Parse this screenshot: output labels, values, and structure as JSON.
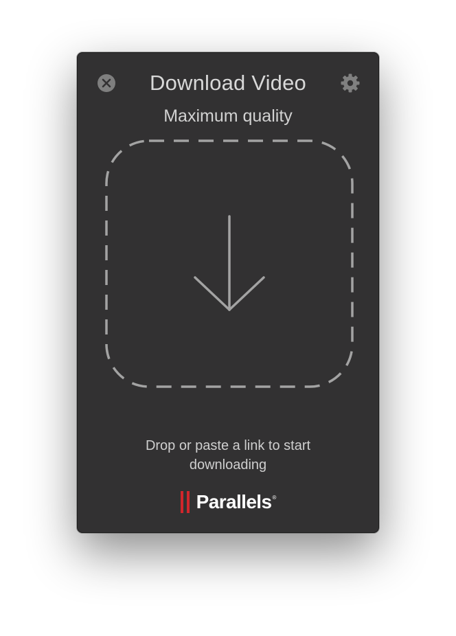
{
  "window": {
    "title": "Download Video",
    "subtitle": "Maximum quality"
  },
  "icons": {
    "close": "close-circle-icon",
    "settings": "gear-icon",
    "download": "arrow-down-icon"
  },
  "drop_zone": {
    "hint": "Drop or paste a link to start downloading"
  },
  "branding": {
    "name": "Parallels",
    "registered_mark": "®",
    "bars_color": "#d1262b"
  },
  "colors": {
    "window_bg": "#323132",
    "dash_stroke": "#a3a3a3",
    "icon_gray": "#808080"
  }
}
